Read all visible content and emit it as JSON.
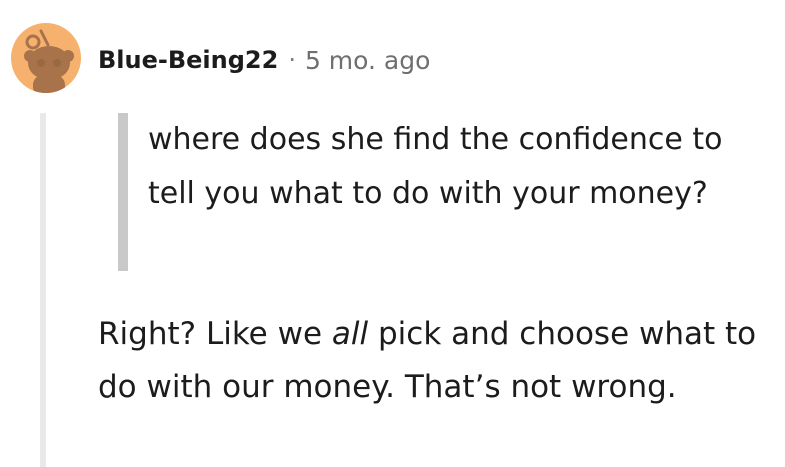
{
  "comment": {
    "username": "Blue-Being22",
    "separator": "·",
    "timestamp": "5 mo. ago",
    "quote": "where does she find the confidence to tell you what to do with your money?",
    "reply": {
      "before": "Right? Like we ",
      "emphasis": "all",
      "after": " pick and choose what to do with our money. That’s not wrong."
    }
  },
  "colors": {
    "avatar_bg": "#f6b16e",
    "avatar_face": "#a8734a",
    "quote_bar": "#c9c9c9",
    "thread_line": "#e9e9e9",
    "text": "#1c1c1c",
    "meta": "#6f6f6f"
  },
  "icons": {
    "avatar": "snoo-avatar-icon"
  }
}
